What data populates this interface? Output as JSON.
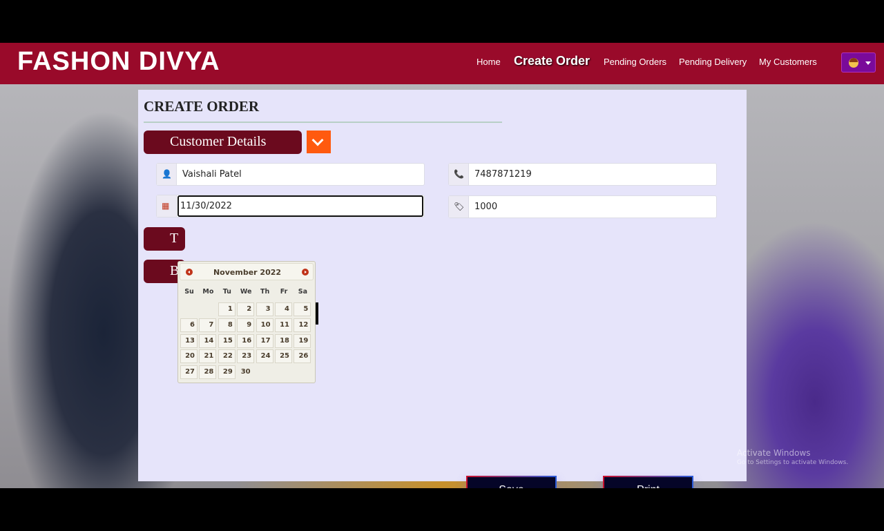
{
  "brand": "FASHON DIVYA",
  "nav": {
    "home": "Home",
    "create_order": "Create Order",
    "pending_orders": "Pending Orders",
    "pending_delivery": "Pending Delivery",
    "my_customers": "My Customers"
  },
  "page": {
    "title": "CREATE ORDER",
    "section_customer": "Customer Details",
    "section_second_initial": "T",
    "section_third_initial": "B"
  },
  "form": {
    "name": "Vaishali Patel",
    "phone": "7487871219",
    "date": "11/30/2022",
    "amount": "1000"
  },
  "calendar": {
    "month_label": "November 2022",
    "weekdays": [
      "Su",
      "Mo",
      "Tu",
      "We",
      "Th",
      "Fr",
      "Sa"
    ],
    "days": [
      "1",
      "2",
      "3",
      "4",
      "5",
      "6",
      "7",
      "8",
      "9",
      "10",
      "11",
      "12",
      "13",
      "14",
      "15",
      "16",
      "17",
      "18",
      "19",
      "20",
      "21",
      "22",
      "23",
      "24",
      "25",
      "26",
      "27",
      "28",
      "29",
      "30"
    ],
    "selected_day": "30"
  },
  "actions": {
    "save": "Save",
    "print": "Print"
  },
  "watermark": {
    "line1": "Activate Windows",
    "line2": "Go to Settings to activate Windows."
  },
  "colors": {
    "navbar": "#990a2a",
    "section_button": "#6b0a1e",
    "toggle": "#ff5a0f",
    "panel": "#e6e4fa",
    "action_button": "#050528"
  }
}
